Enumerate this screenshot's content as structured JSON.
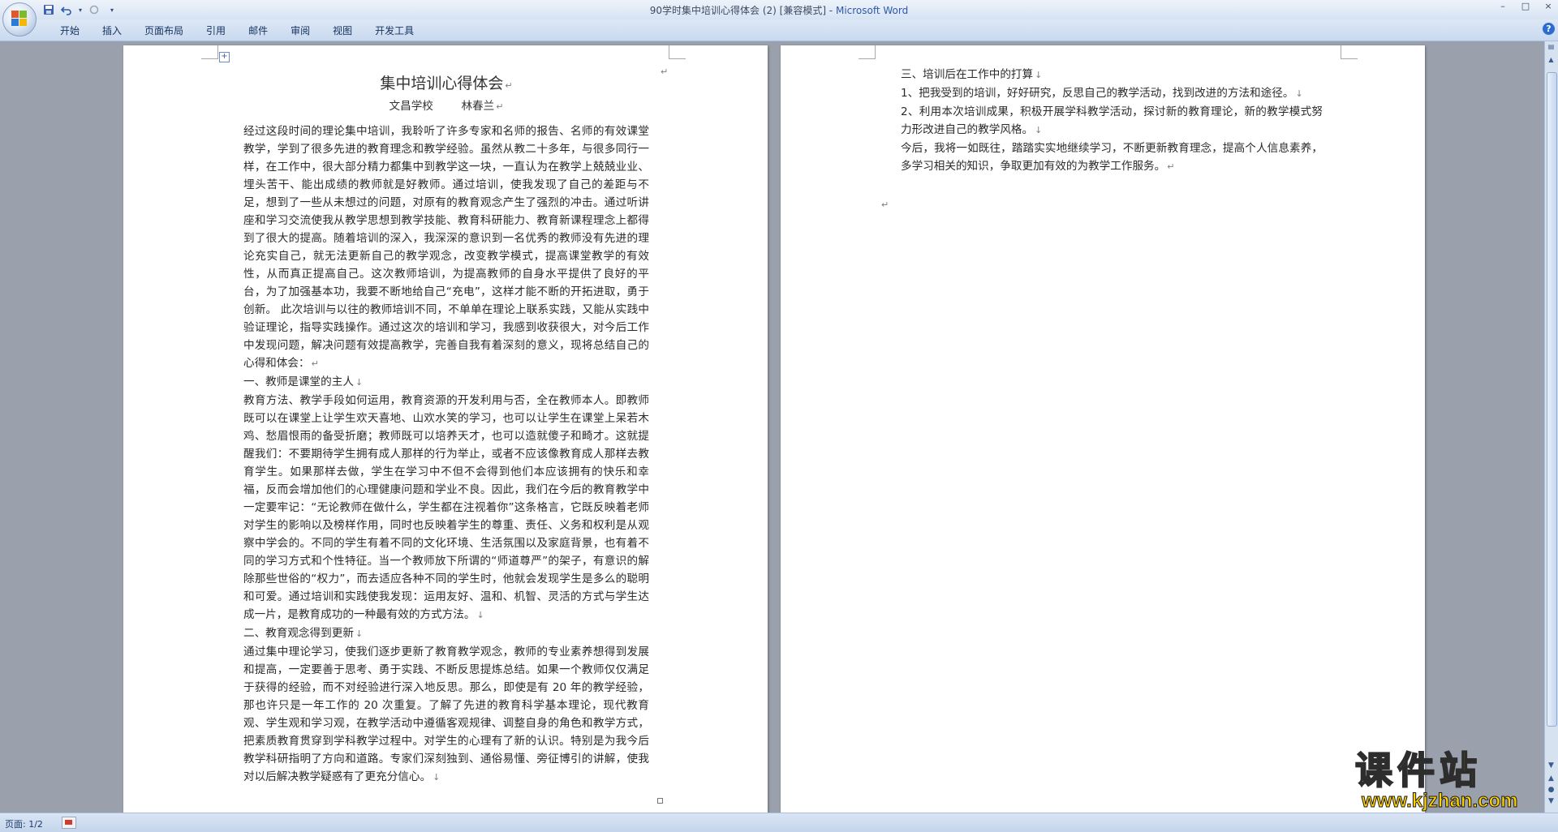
{
  "window": {
    "title": "90学时集中培训心得体会 (2) [兼容模式] - ",
    "app_name": "Microsoft Word",
    "controls": [
      "–",
      "□",
      "×"
    ]
  },
  "quick_access": {
    "save_icon": "save-icon",
    "undo_icon": "undo-icon",
    "redo_icon": "redo-icon",
    "customize_icon": "customize-icon"
  },
  "ribbon": {
    "tabs": [
      "开始",
      "插入",
      "页面布局",
      "引用",
      "邮件",
      "审阅",
      "视图",
      "开发工具"
    ],
    "help": "?"
  },
  "document": {
    "title": "集中培训心得体会",
    "subtitle": "文昌学校        林春兰",
    "page1_paragraphs": [
      "经过这段时间的理论集中培训，我聆听了许多专家和名师的报告、名师的有效课堂教学，学到了很多先进的教育理念和教学经验。虽然从教二十多年，与很多同行一样，在工作中，很大部分精力都集中到教学这一块，一直认为在教学上兢兢业业、埋头苦干、能出成绩的教师就是好教师。通过培训，使我发现了自己的差距与不足，想到了一些从未想过的问题，对原有的教育观念产生了强烈的冲击。通过听讲座和学习交流使我从教学思想到教学技能、教育科研能力、教育新课程理念上都得到了很大的提高。随着培训的深入，我深深的意识到一名优秀的教师没有先进的理论充实自己，就无法更新自己的教学观念，改变教学模式，提高课堂教学的有效性，从而真正提高自己。这次教师培训，为提高教师的自身水平提供了良好的平台，为了加强基本功，我要不断地给自己“充电”，这样才能不断的开拓进取，勇于创新。 此次培训与以往的教师培训不同，不单单在理论上联系实践，又能从实践中验证理论，指导实践操作。通过这次的培训和学习，我感到收获很大，对今后工作中发现问题，解决问题有效提高教学，完善自我有着深刻的意义，现将总结自己的心得和体会：",
      "一、教师是课堂的主人",
      "教育方法、教学手段如何运用，教育资源的开发利用与否，全在教师本人。即教师既可以在课堂上让学生欢天喜地、山欢水笑的学习，也可以让学生在课堂上呆若木鸡、愁眉恨雨的备受折磨；教师既可以培养天才，也可以造就傻子和畸才。这就提醒我们：不要期待学生拥有成人那样的行为举止，或者不应该像教育成人那样去教育学生。如果那样去做，学生在学习中不但不会得到他们本应该拥有的快乐和幸福，反而会增加他们的心理健康问题和学业不良。因此，我们在今后的教育教学中一定要牢记：“无论教师在做什么，学生都在注视着你”这条格言，它既反映着老师对学生的影响以及榜样作用，同时也反映着学生的尊重、责任、义务和权利是从观察中学会的。不同的学生有着不同的文化环境、生活氛围以及家庭背景，也有着不同的学习方式和个性特征。当一个教师放下所谓的“师道尊严”的架子，有意识的解除那些世俗的“权力”，而去适应各种不同的学生时，他就会发现学生是多么的聪明和可爱。通过培训和实践使我发现：运用友好、温和、机智、灵活的方式与学生达成一片，是教育成功的一种最有效的方式方法。",
      "二、教育观念得到更新",
      "通过集中理论学习，使我们逐步更新了教育教学观念，教师的专业素养想得到发展和提高，一定要善于思考、勇于实践、不断反思提炼总结。如果一个教师仅仅满足于获得的经验，而不对经验进行深入地反思。那么，即使是有 20 年的教学经验，那也许只是一年工作的 20 次重复。了解了先进的教育科学基本理论，现代教育观、学生观和学习观，在教学活动中遵循客观规律、调整自身的角色和教学方式，把素质教育贯穿到学科教学过程中。对学生的心理有了新的认识。特别是为我今后教学科研指明了方向和道路。专家们深刻独到、通俗易懂、旁征博引的讲解，使我对以后解决教学疑惑有了更充分信心。"
    ],
    "page2_paragraphs": [
      "三、培训后在工作中的打算",
      "1、把我受到的培训，好好研究，反思自己的教学活动，找到改进的方法和途径。",
      "2、利用本次培训成果，积极开展学科教学活动，探讨新的教育理论，新的教学模式努力形改进自己的教学风格。",
      "今后，我将一如既往，踏踏实实地继续学习，不断更新教育理念，提高个人信息素养，多学习相关的知识，争取更加有效的为教学工作服务。"
    ],
    "paragraph_mark": "↵",
    "line_break_mark": "↓"
  },
  "status": {
    "page_info": "页面: 1/2"
  },
  "watermark": {
    "main": "课件站",
    "url": "www.kjzhan.com"
  },
  "colors": {
    "ribbon_bg": "#c9d9ef",
    "workspace_bg": "#9aa1ad",
    "watermark_yellow": "#f2d400"
  }
}
